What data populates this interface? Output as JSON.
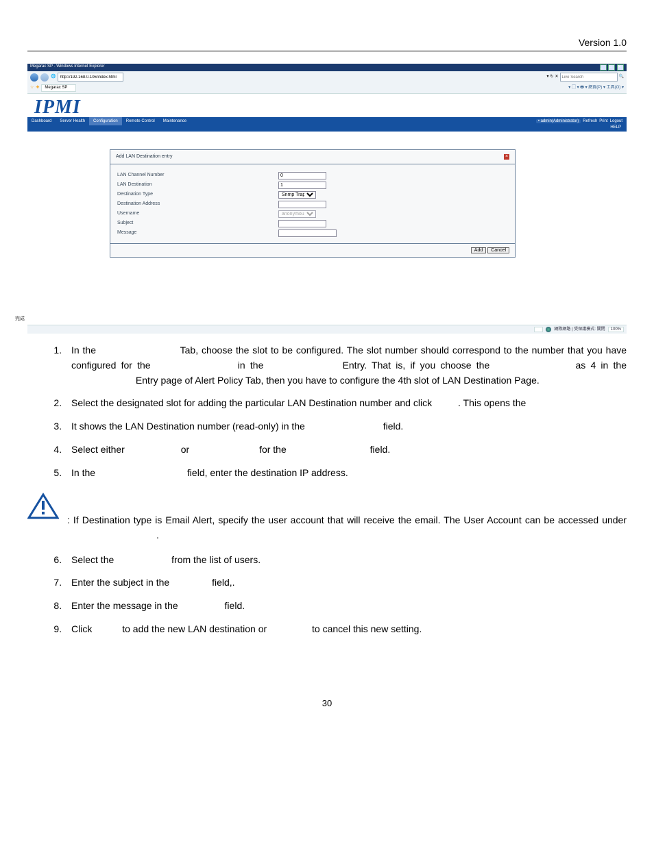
{
  "doc": {
    "version": "Version 1.0",
    "page_number": "30"
  },
  "ie": {
    "title": "Megarac SP - Windows Internet Explorer",
    "url": "http://192.168.0.106/index.html",
    "search_provider": "Live Search",
    "tab_label": "Megarac SP",
    "tools_text": "▾ ▢ ▾ 🖶 ▾ 網頁(P) ▾ 工具(O) ▾",
    "ctrl_min": "_",
    "ctrl_max": "□",
    "ctrl_close": "✕",
    "fav_star": "☆",
    "fav_plus": "✚",
    "go_icon": "➔",
    "search_icon": "🔍",
    "status_done": "完成",
    "status_mode": "網際網路 | 受保護模式: 關閉",
    "status_zoom": "100%"
  },
  "ipmi": {
    "logo": "IPMI",
    "menu": [
      "Dashboard",
      "Server Health",
      "Configuration",
      "Remote Control",
      "Maintenance"
    ],
    "meta_user": "• admin(Administrator)",
    "meta_refresh": "Refresh",
    "meta_print": "Print",
    "meta_logout": "Logout",
    "meta_help": "HELP"
  },
  "panel": {
    "title": "Add LAN Destination entry",
    "close_glyph": "×",
    "rows": {
      "lan_channel_number": {
        "label": "LAN Channel Number",
        "value": "0"
      },
      "lan_destination": {
        "label": "LAN Destination",
        "value": "1"
      },
      "destination_type": {
        "label": "Destination Type",
        "value": "Snmp Trap"
      },
      "destination_address": {
        "label": "Destination Address",
        "value": ""
      },
      "username": {
        "label": "Username",
        "value": "anonymous"
      },
      "subject": {
        "label": "Subject",
        "value": ""
      },
      "message": {
        "label": "Message",
        "value": ""
      }
    },
    "actions": {
      "add": "Add",
      "cancel": "Cancel"
    }
  },
  "steps_a": {
    "i1a": "In the",
    "i1b": "Tab, choose the slot to be configured. The slot number should correspond to the number that you have configured for the",
    "i1c": "in the",
    "i1d": "Entry. That is, if you choose the",
    "i1e": "as 4 in the",
    "i1f": "Entry page of Alert Policy Tab, then you have to configure the 4th slot of LAN Destination Page.",
    "i2a": "Select the designated slot for adding the particular LAN Destination number and click",
    "i2b": ". This opens the",
    "i3a": "It shows the LAN Destination number (read-only) in the",
    "i3b": "field.",
    "i4a": "Select either",
    "i4b": "or",
    "i4c": "for the",
    "i4d": "field.",
    "i5a": "In the",
    "i5b": "field, enter the destination IP address."
  },
  "note": {
    "prefix": ": If Destination type is Email Alert, specify the user account that will receive the email. The User Account can be accessed under",
    "suffix": "."
  },
  "steps_b": {
    "i6a": "Select the",
    "i6b": "from the list of users.",
    "i7a": "Enter the subject in the",
    "i7b": "field,.",
    "i8a": "Enter the message in the",
    "i8b": "field.",
    "i9a": "Click",
    "i9b": "to add the new LAN destination or",
    "i9c": "to cancel this new setting."
  }
}
